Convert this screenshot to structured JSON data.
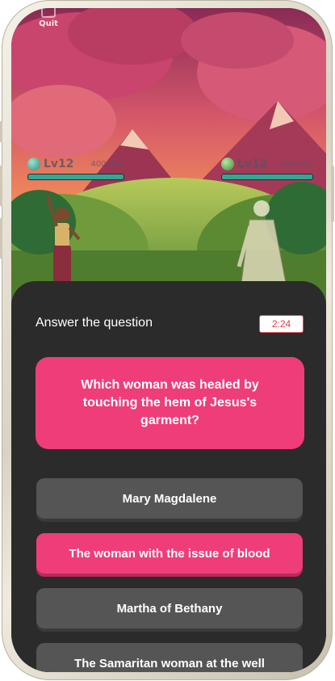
{
  "game": {
    "quit_label": "Quit",
    "player": {
      "level": "Lv12",
      "hp": "400/400",
      "hp_fraction": 1.0,
      "gem_color": "#2e8c7a"
    },
    "opponent": {
      "level": "Lv12",
      "hp": "400/400",
      "hp_fraction": 1.0,
      "gem_color": "#3b8c3b"
    }
  },
  "quiz": {
    "title": "Answer the question",
    "timer": "2:24",
    "question": "Which woman was healed by touching the hem of Jesus's garment?",
    "answers": [
      {
        "label": "Mary Magdalene",
        "selected": false
      },
      {
        "label": "The woman with the issue of blood",
        "selected": true
      },
      {
        "label": "Martha of Bethany",
        "selected": false
      },
      {
        "label": "The Samaritan woman at the well",
        "selected": false
      }
    ]
  },
  "colors": {
    "accent": "#ef3d7a",
    "panel": "#2b2b2b",
    "answer": "#555555",
    "timer_border": "#e5525a"
  }
}
